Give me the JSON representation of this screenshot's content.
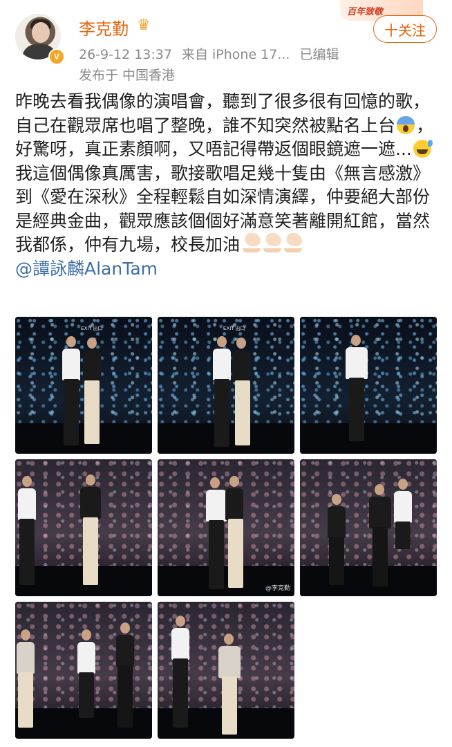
{
  "header": {
    "username": "李克勤",
    "verified_badge": "V",
    "timestamp": "26-9-12 13:37",
    "source": "来自 iPhone 17...",
    "edited": "已编辑",
    "location_prefix": "发布于",
    "location": "中国香港",
    "follow_label": "十关注",
    "promo_text": "百年致敬"
  },
  "post": {
    "paragraph1_a": "昨晚去看我偶像的演唱會，聽到了很多很有回憶的歌，自己在觀眾席也唱了整晚，誰不知突然被點名上台",
    "paragraph1_b": "，好驚呀，真正素顏啊，又唔記得帶返個眼鏡遮一遮...",
    "paragraph2": "我這個偶像真厲害，歌接歌唱足幾十隻由《無言感激》到《愛在深秋》全程輕鬆自如深情演繹，仲要絕大部份是經典金曲，觀眾應該個個好滿意笑著離開紅館，當然我都係，仲有九場，校長加油",
    "mention": "@譚詠麟AlanTam"
  },
  "photos": {
    "exit_sign": "EXIT 出口",
    "watermark": "@李克勤"
  },
  "icons": {
    "avatar": "avatar-photo",
    "crown": "crown-icon",
    "emoji1": "screaming-face-emoji",
    "emoji2": "grinning-sweat-emoji",
    "arms": "flexed-biceps-emoji"
  },
  "colors": {
    "username": "#e8640c",
    "mention": "#3e6ea8",
    "meta": "#8a8a8a"
  }
}
